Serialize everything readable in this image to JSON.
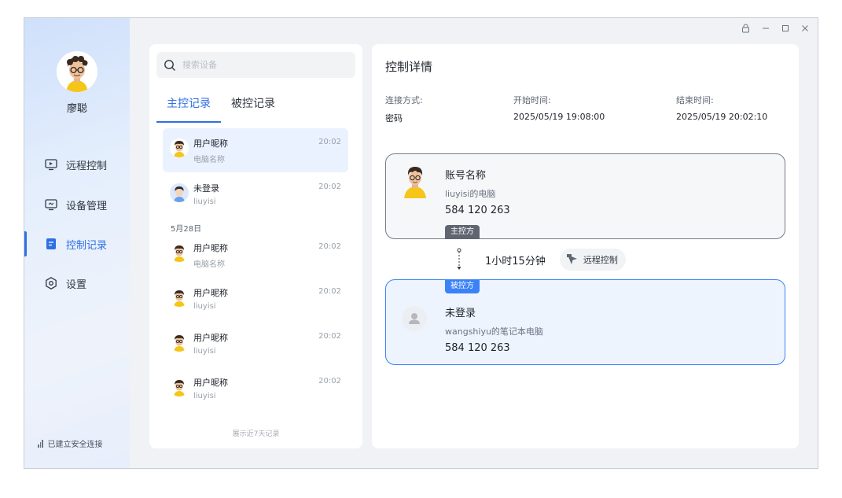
{
  "user": {
    "name": "廖聪"
  },
  "nav": [
    {
      "label": "远程控制",
      "icon": "remote-desktop-icon"
    },
    {
      "label": "设备管理",
      "icon": "monitor-icon"
    },
    {
      "label": "控制记录",
      "icon": "document-icon"
    },
    {
      "label": "设置",
      "icon": "settings-icon"
    }
  ],
  "active_nav": "控制记录",
  "status": {
    "label": "已建立安全连接",
    "icon": "signal-icon"
  },
  "search": {
    "placeholder": "搜索设备",
    "value": ""
  },
  "tabs": [
    {
      "label": "主控记录"
    },
    {
      "label": "被控记录"
    }
  ],
  "active_tab": "主控记录",
  "records": [
    {
      "name": "用户昵称",
      "sub": "电脑名称",
      "time": "20:02",
      "avatar": "cartoon"
    },
    {
      "name": "未登录",
      "sub": "liuyisi",
      "time": "20:02",
      "avatar": "kid"
    },
    {
      "name": "用户昵称",
      "sub": "电脑名称",
      "time": "20:02",
      "avatar": "cartoon"
    },
    {
      "name": "用户昵称",
      "sub": "liuyisi",
      "time": "20:02",
      "avatar": "cartoon"
    },
    {
      "name": "用户昵称",
      "sub": "liuyisi",
      "time": "20:02",
      "avatar": "cartoon"
    },
    {
      "name": "用户昵称",
      "sub": "liuyisi",
      "time": "20:02",
      "avatar": "cartoon"
    }
  ],
  "date_group": "5月28日",
  "list_footer": "展示近7天记录",
  "detail": {
    "title": "控制详情",
    "connection_method": {
      "label": "连接方式:",
      "value": "密码"
    },
    "start_time": {
      "label": "开始时间:",
      "value": "2025/05/19 19:08:00"
    },
    "end_time": {
      "label": "结束时间:",
      "value": "2025/05/19 20:02:10"
    },
    "controller": {
      "name": "账号名称",
      "pc": "liuyisi的电脑",
      "id": "584 120 263",
      "role": "主控方"
    },
    "controlled": {
      "name": "未登录",
      "pc": "wangshiyu的笔记本电脑",
      "id": "584 120 263",
      "role": "被控方"
    },
    "duration": "1小时15分钟",
    "action_label": "远程控制"
  },
  "colors": {
    "accent": "#2f6fe4",
    "controlled_border": "#3b82f6",
    "controller_tag": "#5f6672"
  }
}
